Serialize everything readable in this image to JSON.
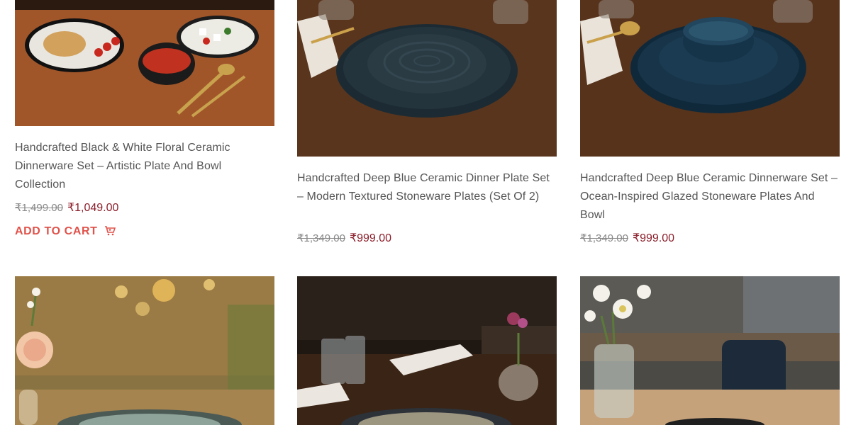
{
  "products": [
    {
      "title": "Handcrafted Black & White Floral Ceramic Dinnerware Set – Artistic Plate And Bowl Collection",
      "old_price": "₹1,499.00",
      "new_price": "₹1,049.00",
      "cta": "ADD TO CART",
      "image_alt": "black-white-floral-dinnerware-photo"
    },
    {
      "title": "Handcrafted Deep Blue Ceramic Dinner Plate Set – Modern Textured Stoneware Plates (Set Of 2)",
      "old_price": "₹1,349.00",
      "new_price": "₹999.00",
      "image_alt": "deep-blue-dinner-plates-photo"
    },
    {
      "title": "Handcrafted Deep Blue Ceramic Dinnerware Set – Ocean-Inspired Glazed Stoneware Plates And Bowl",
      "old_price": "₹1,349.00",
      "new_price": "₹999.00",
      "image_alt": "deep-blue-dinnerware-bowl-photo"
    },
    {
      "image_alt": "sage-green-plate-with-flowers-photo"
    },
    {
      "image_alt": "cream-plate-restaurant-table-photo"
    },
    {
      "image_alt": "white-flowers-table-plate-photo"
    }
  ],
  "colors": {
    "sale_price": "#8b1e2a",
    "add_to_cart": "#e0524a",
    "title_text": "#555555",
    "wood_table": "#6b3f22"
  },
  "icons": {
    "cart": "cart-icon"
  }
}
